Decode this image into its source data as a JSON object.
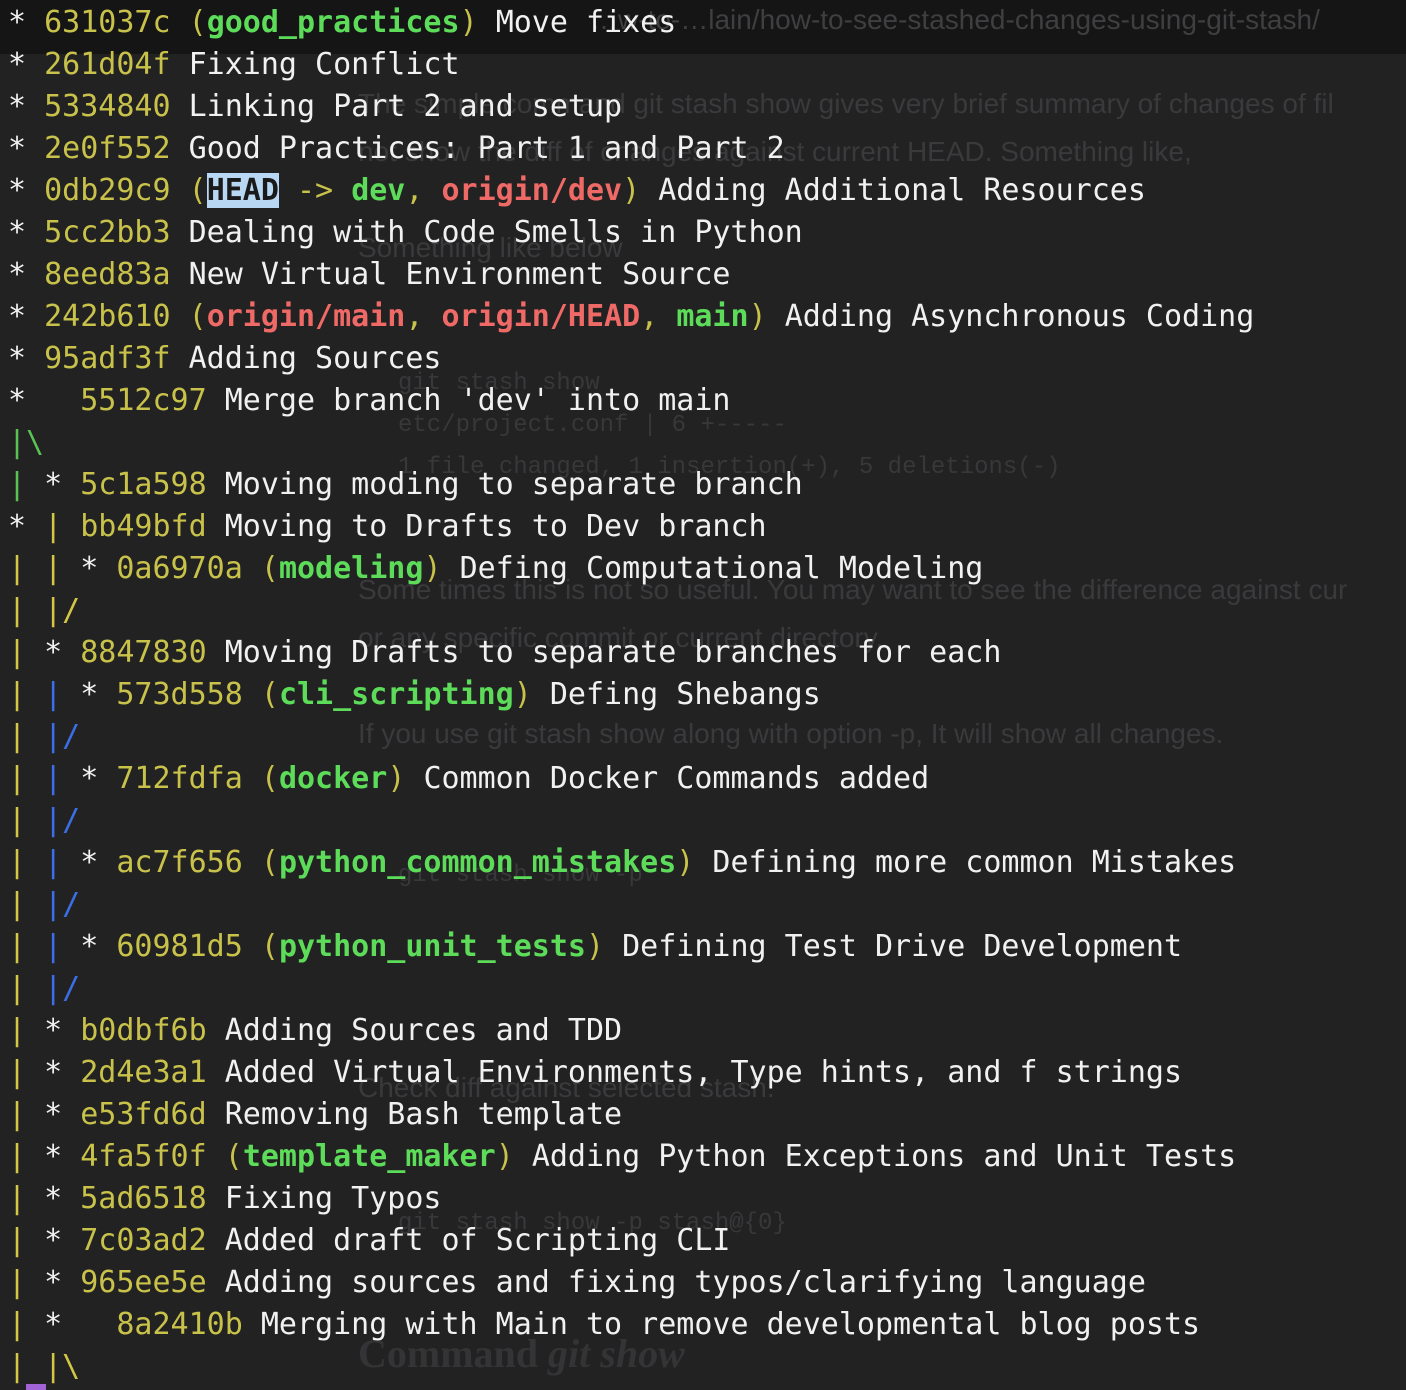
{
  "background_page": {
    "url_text": "…w-to-…lain/how-to-see-stashed-changes-using-git-stash/",
    "para1": "The simple command git stash show  gives very brief summary of changes of fil",
    "para2": "not show the diff of changes against current HEAD. Something like,",
    "para3": "Something like below",
    "code1": "git stash show",
    "code2": "etc/project.conf | 6 +-----",
    "code3": "1 file changed, 1 insertion(+), 5 deletions(-)",
    "para4": "Some times this is not so useful. You may want to see the difference against  cur",
    "para5": "or any specific commit or current directory.",
    "para6": "If you use git stash show along with option -p, It will show all changes.",
    "code4": "git stash show -p",
    "para7": "Check diff against selected stash.",
    "code5": "git stash show -p stash@{0}",
    "heading_plain": "Command ",
    "heading_italic": "git show"
  },
  "terminal": {
    "lines": [
      {
        "graph": [
          [
            "* ",
            "white"
          ]
        ],
        "hash": "631037c",
        "refs": [
          {
            "text": "good_practices",
            "type": "local"
          }
        ],
        "message": "Move fixes"
      },
      {
        "graph": [
          [
            "* ",
            "white"
          ]
        ],
        "hash": "261d04f",
        "refs": [],
        "message": "Fixing Conflict"
      },
      {
        "graph": [
          [
            "* ",
            "white"
          ]
        ],
        "hash": "5334840",
        "refs": [],
        "message": "Linking Part 2 and setup"
      },
      {
        "graph": [
          [
            "* ",
            "white"
          ]
        ],
        "hash": "2e0f552",
        "refs": [],
        "message": "Good Practices: Part 1 and Part 2"
      },
      {
        "graph": [
          [
            "* ",
            "white"
          ]
        ],
        "hash": "0db29c9",
        "head": true,
        "refs": [
          {
            "text": "dev",
            "type": "local"
          },
          {
            "text": "origin/dev",
            "type": "remote"
          }
        ],
        "message": "Adding Additional Resources"
      },
      {
        "graph": [
          [
            "* ",
            "white"
          ]
        ],
        "hash": "5cc2bb3",
        "refs": [],
        "message": "Dealing with Code Smells in Python"
      },
      {
        "graph": [
          [
            "* ",
            "white"
          ]
        ],
        "hash": "8eed83a",
        "refs": [],
        "message": "New Virtual Environment Source"
      },
      {
        "graph": [
          [
            "* ",
            "white"
          ]
        ],
        "hash": "242b610",
        "refs": [
          {
            "text": "origin/main",
            "type": "remote"
          },
          {
            "text": "origin/HEAD",
            "type": "remote"
          },
          {
            "text": "main",
            "type": "local"
          }
        ],
        "message": "Adding Asynchronous Coding"
      },
      {
        "graph": [
          [
            "* ",
            "white"
          ]
        ],
        "hash": "95adf3f",
        "refs": [],
        "message": "Adding Sources"
      },
      {
        "graph": [
          [
            "*   ",
            "white"
          ]
        ],
        "hash": "5512c97",
        "refs": [],
        "message": "Merge branch 'dev' into main"
      },
      {
        "graph": [
          [
            "|\\",
            "green"
          ]
        ]
      },
      {
        "graph": [
          [
            "| ",
            "green"
          ],
          [
            "* ",
            "white"
          ]
        ],
        "hash": "5c1a598",
        "refs": [],
        "message": "Moving moding to separate branch"
      },
      {
        "graph": [
          [
            "* ",
            "white"
          ],
          [
            "| ",
            "yellow"
          ]
        ],
        "hash": "bb49bfd",
        "refs": [],
        "message": "Moving to Drafts to Dev branch"
      },
      {
        "graph": [
          [
            "| ",
            "yellow"
          ],
          [
            "| ",
            "yellow"
          ],
          [
            "* ",
            "white"
          ]
        ],
        "hash": "0a6970a",
        "refs": [
          {
            "text": "modeling",
            "type": "local"
          }
        ],
        "message": "Defing Computational Modeling"
      },
      {
        "graph": [
          [
            "| ",
            "yellow"
          ],
          [
            "|/",
            "yellow"
          ]
        ]
      },
      {
        "graph": [
          [
            "| ",
            "yellow"
          ],
          [
            "* ",
            "white"
          ]
        ],
        "hash": "8847830",
        "refs": [],
        "message": "Moving Drafts to separate branches for each"
      },
      {
        "graph": [
          [
            "| ",
            "yellow"
          ],
          [
            "| ",
            "blue"
          ],
          [
            "* ",
            "white"
          ]
        ],
        "hash": "573d558",
        "refs": [
          {
            "text": "cli_scripting",
            "type": "local"
          }
        ],
        "message": "Defing Shebangs"
      },
      {
        "graph": [
          [
            "| ",
            "yellow"
          ],
          [
            "|/",
            "blue"
          ]
        ]
      },
      {
        "graph": [
          [
            "| ",
            "yellow"
          ],
          [
            "| ",
            "blue"
          ],
          [
            "* ",
            "white"
          ]
        ],
        "hash": "712fdfa",
        "refs": [
          {
            "text": "docker",
            "type": "local"
          }
        ],
        "message": "Common Docker Commands added"
      },
      {
        "graph": [
          [
            "| ",
            "yellow"
          ],
          [
            "|/",
            "blue"
          ]
        ]
      },
      {
        "graph": [
          [
            "| ",
            "yellow"
          ],
          [
            "| ",
            "blue"
          ],
          [
            "* ",
            "white"
          ]
        ],
        "hash": "ac7f656",
        "refs": [
          {
            "text": "python_common_mistakes",
            "type": "local"
          }
        ],
        "message": "Defining more common Mistakes"
      },
      {
        "graph": [
          [
            "| ",
            "yellow"
          ],
          [
            "|/",
            "blue"
          ]
        ]
      },
      {
        "graph": [
          [
            "| ",
            "yellow"
          ],
          [
            "| ",
            "blue"
          ],
          [
            "* ",
            "white"
          ]
        ],
        "hash": "60981d5",
        "refs": [
          {
            "text": "python_unit_tests",
            "type": "local"
          }
        ],
        "message": "Defining Test Drive Development"
      },
      {
        "graph": [
          [
            "| ",
            "yellow"
          ],
          [
            "|/",
            "blue"
          ]
        ]
      },
      {
        "graph": [
          [
            "| ",
            "yellow"
          ],
          [
            "* ",
            "white"
          ]
        ],
        "hash": "b0dbf6b",
        "refs": [],
        "message": "Adding Sources and TDD"
      },
      {
        "graph": [
          [
            "| ",
            "yellow"
          ],
          [
            "* ",
            "white"
          ]
        ],
        "hash": "2d4e3a1",
        "refs": [],
        "message": "Added Virtual Environments, Type hints, and f strings"
      },
      {
        "graph": [
          [
            "| ",
            "yellow"
          ],
          [
            "* ",
            "white"
          ]
        ],
        "hash": "e53fd6d",
        "refs": [],
        "message": "Removing Bash template"
      },
      {
        "graph": [
          [
            "| ",
            "yellow"
          ],
          [
            "* ",
            "white"
          ]
        ],
        "hash": "4fa5f0f",
        "refs": [
          {
            "text": "template_maker",
            "type": "local"
          }
        ],
        "message": "Adding Python Exceptions and Unit Tests"
      },
      {
        "graph": [
          [
            "| ",
            "yellow"
          ],
          [
            "* ",
            "white"
          ]
        ],
        "hash": "5ad6518",
        "refs": [],
        "message": "Fixing Typos"
      },
      {
        "graph": [
          [
            "| ",
            "yellow"
          ],
          [
            "* ",
            "white"
          ]
        ],
        "hash": "7c03ad2",
        "refs": [],
        "message": "Added draft of Scripting CLI"
      },
      {
        "graph": [
          [
            "| ",
            "yellow"
          ],
          [
            "* ",
            "white"
          ]
        ],
        "hash": "965ee5e",
        "refs": [],
        "message": "Adding sources and fixing typos/clarifying language"
      },
      {
        "graph": [
          [
            "| ",
            "yellow"
          ],
          [
            "*   ",
            "white"
          ]
        ],
        "hash": "8a2410b",
        "refs": [],
        "message": "Merging with Main to remove developmental blog posts"
      },
      {
        "graph": [
          [
            "| ",
            "yellow"
          ],
          [
            "|\\",
            "yellow"
          ]
        ]
      }
    ],
    "head_label": "HEAD",
    "head_arrow": " -> ",
    "colors": {
      "hash": "#c9c24a",
      "local_branch": "#5ddc5a",
      "remote_branch": "#ef6a66",
      "head_highlight": "#b8d7f3",
      "graph_green": "#58c252",
      "graph_yellow": "#d3c744",
      "graph_blue": "#3a6fe6",
      "text": "#f1f1f1",
      "background": "#222223"
    }
  }
}
